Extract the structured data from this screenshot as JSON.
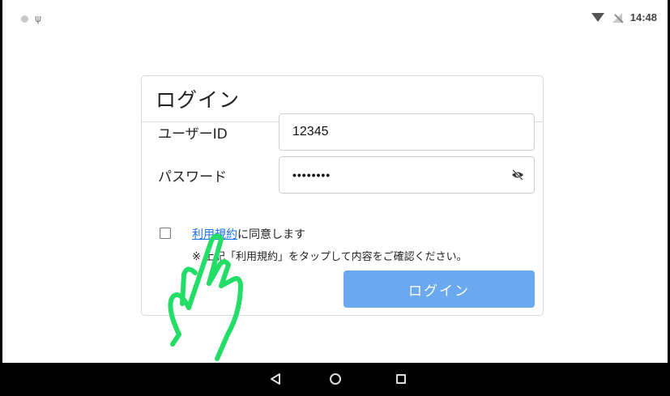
{
  "status_bar": {
    "time": "14:48",
    "left_icons": [
      "notification-dot-icon",
      "usb-icon"
    ],
    "right_icons": [
      "wifi-icon",
      "no-signal-icon"
    ]
  },
  "login_card": {
    "title": "ログイン",
    "user_id": {
      "label": "ユーザーID",
      "value": "12345"
    },
    "password": {
      "label": "パスワード",
      "value": "••••••••",
      "toggle_icon": "eye-off-icon"
    },
    "agreement": {
      "checked": false,
      "link_text": "利用規約",
      "suffix_text": "に同意します",
      "note": "※ 上記「利用規約」をタップして内容をご確認ください。"
    },
    "submit_label": "ログイン"
  },
  "colors": {
    "link": "#1a73e8",
    "button": "#6aa8ef",
    "hand_overlay": "#22dd66"
  },
  "nav_bar": {
    "buttons": [
      "back-icon",
      "home-icon",
      "recents-icon"
    ]
  }
}
